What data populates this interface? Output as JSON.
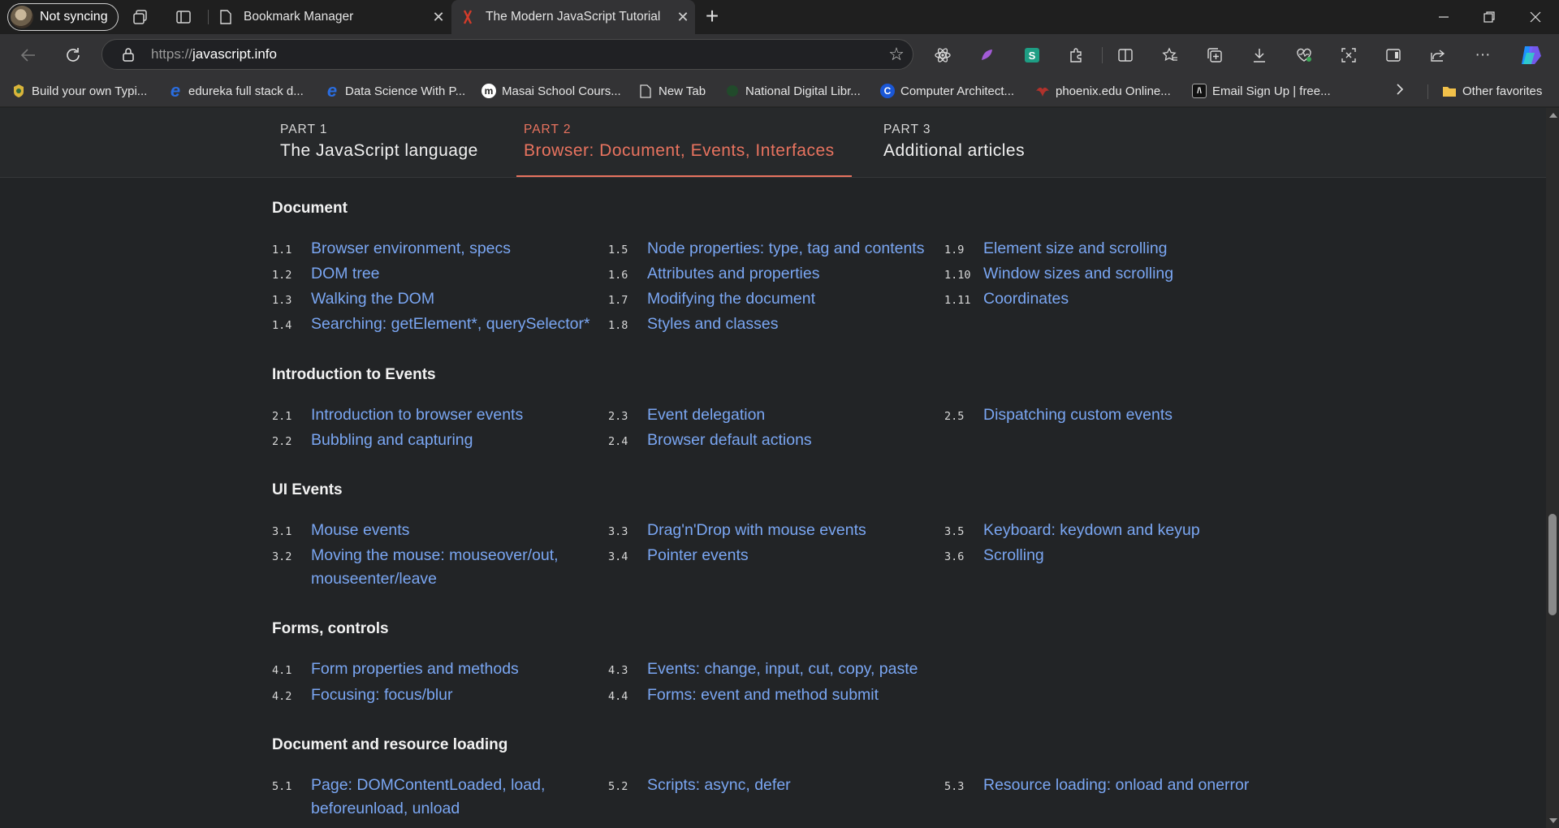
{
  "browser": {
    "profile_label": "Not syncing",
    "tabs": [
      {
        "title": "Bookmark Manager",
        "active": false
      },
      {
        "title": "The Modern JavaScript Tutorial",
        "active": true
      }
    ],
    "url_prefix": "https://",
    "url_host": "javascript.info",
    "bookmarks": [
      {
        "label": "Build your own Typi...",
        "icon": "site-icon"
      },
      {
        "label": "edureka full stack d...",
        "icon": "edureka-icon"
      },
      {
        "label": "Data Science With P...",
        "icon": "edureka-icon"
      },
      {
        "label": "Masai School Cours...",
        "icon": "masai-icon"
      },
      {
        "label": "New Tab",
        "icon": "page-icon"
      },
      {
        "label": "National Digital Libr...",
        "icon": "globe-icon"
      },
      {
        "label": "Computer Architect...",
        "icon": "c-icon"
      },
      {
        "label": "phoenix.edu Online...",
        "icon": "phoenix-icon"
      },
      {
        "label": "Email Sign Up | free...",
        "icon": "brackets-icon"
      }
    ],
    "other_favorites": "Other favorites"
  },
  "parts": [
    {
      "num": "PART 1",
      "name": "The JavaScript language",
      "active": false
    },
    {
      "num": "PART 2",
      "name": "Browser: Document, Events, Interfaces",
      "active": true
    },
    {
      "num": "PART 3",
      "name": "Additional articles",
      "active": false
    }
  ],
  "sections": [
    {
      "title": "Document",
      "items": [
        {
          "num": "1.1",
          "text": "Browser environment, specs"
        },
        {
          "num": "1.2",
          "text": "DOM tree"
        },
        {
          "num": "1.3",
          "text": "Walking the DOM"
        },
        {
          "num": "1.4",
          "text": "Searching: getElement*, querySelector*"
        },
        {
          "num": "1.5",
          "text": "Node properties: type, tag and contents"
        },
        {
          "num": "1.6",
          "text": "Attributes and properties"
        },
        {
          "num": "1.7",
          "text": "Modifying the document"
        },
        {
          "num": "1.8",
          "text": "Styles and classes"
        },
        {
          "num": "1.9",
          "text": "Element size and scrolling"
        },
        {
          "num": "1.10",
          "text": "Window sizes and scrolling"
        },
        {
          "num": "1.11",
          "text": "Coordinates"
        }
      ]
    },
    {
      "title": "Introduction to Events",
      "items": [
        {
          "num": "2.1",
          "text": "Introduction to browser events"
        },
        {
          "num": "2.2",
          "text": "Bubbling and capturing"
        },
        {
          "num": "2.3",
          "text": "Event delegation"
        },
        {
          "num": "2.4",
          "text": "Browser default actions"
        },
        {
          "num": "2.5",
          "text": "Dispatching custom events"
        }
      ]
    },
    {
      "title": "UI Events",
      "items": [
        {
          "num": "3.1",
          "text": "Mouse events"
        },
        {
          "num": "3.2",
          "text": "Moving the mouse: mouseover/out, mouseenter/leave"
        },
        {
          "num": "3.3",
          "text": "Drag'n'Drop with mouse events"
        },
        {
          "num": "3.4",
          "text": "Pointer events"
        },
        {
          "num": "3.5",
          "text": "Keyboard: keydown and keyup"
        },
        {
          "num": "3.6",
          "text": "Scrolling"
        }
      ]
    },
    {
      "title": "Forms, controls",
      "items": [
        {
          "num": "4.1",
          "text": "Form properties and methods"
        },
        {
          "num": "4.2",
          "text": "Focusing: focus/blur"
        },
        {
          "num": "4.3",
          "text": "Events: change, input, cut, copy, paste"
        },
        {
          "num": "4.4",
          "text": "Forms: event and method submit"
        }
      ]
    },
    {
      "title": "Document and resource loading",
      "items": [
        {
          "num": "5.1",
          "text": "Page: DOMContentLoaded, load, beforeunload, unload"
        },
        {
          "num": "5.2",
          "text": "Scripts: async, defer"
        },
        {
          "num": "5.3",
          "text": "Resource loading: onload and onerror"
        }
      ]
    }
  ],
  "colors": {
    "link": "#7aa6f2",
    "accent": "#e8735f",
    "background": "#222426"
  }
}
